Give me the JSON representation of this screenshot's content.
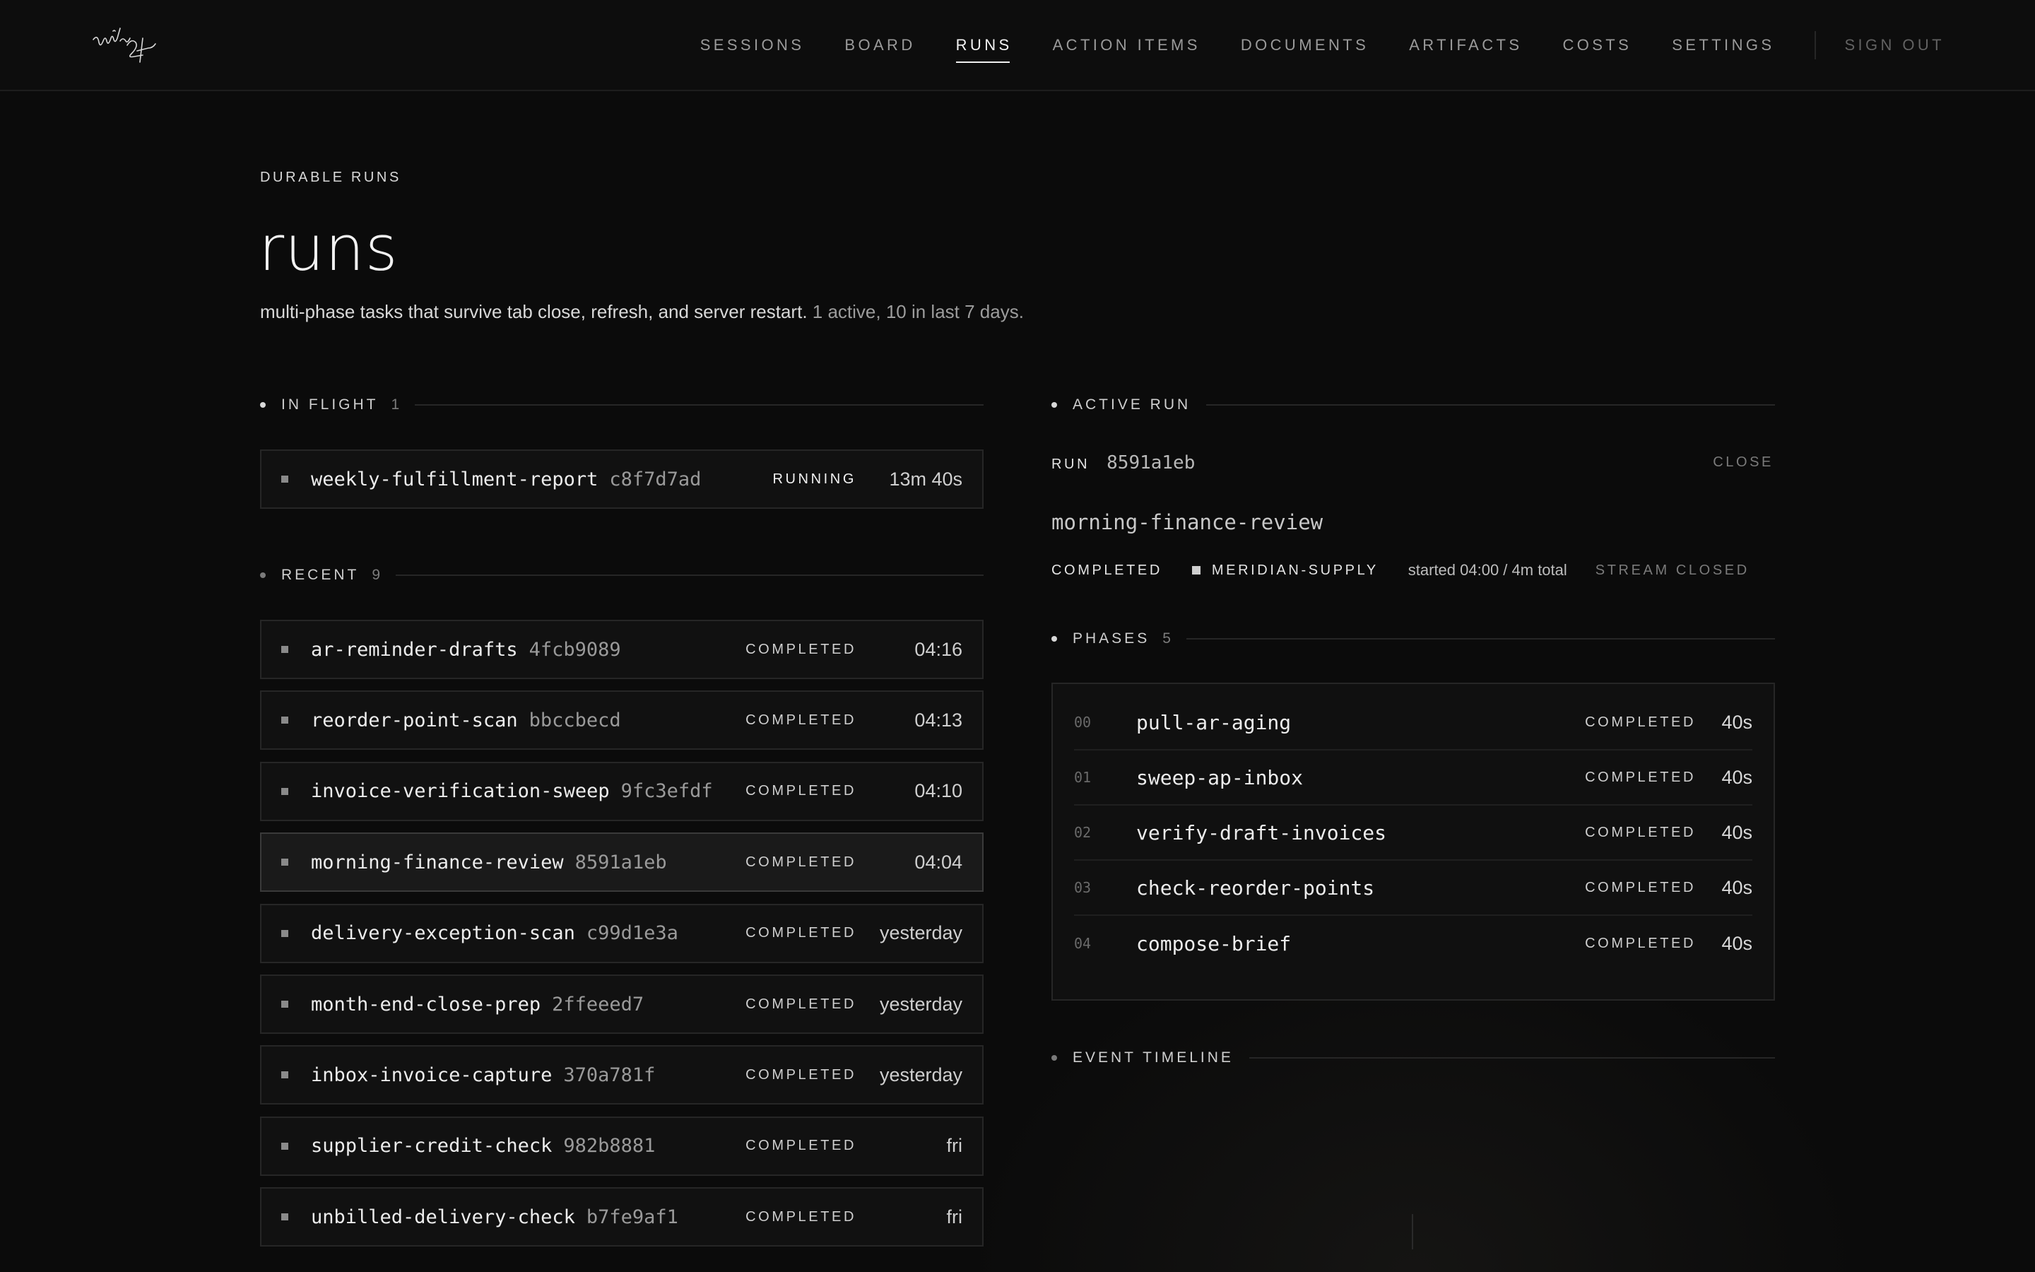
{
  "nav": {
    "items": [
      {
        "label": "SESSIONS",
        "active": false
      },
      {
        "label": "BOARD",
        "active": false
      },
      {
        "label": "RUNS",
        "active": true
      },
      {
        "label": "ACTION ITEMS",
        "active": false
      },
      {
        "label": "DOCUMENTS",
        "active": false
      },
      {
        "label": "ARTIFACTS",
        "active": false
      },
      {
        "label": "COSTS",
        "active": false
      },
      {
        "label": "SETTINGS",
        "active": false
      }
    ],
    "signout": "SIGN OUT"
  },
  "hero": {
    "eyebrow": "DURABLE RUNS",
    "title": "runs",
    "subtitle": "multi-phase tasks that survive tab close, refresh, and server restart.",
    "summary": "1 active, 10 in last 7 days."
  },
  "in_flight": {
    "label": "IN FLIGHT",
    "count": "1",
    "runs": [
      {
        "name": "weekly-fulfillment-report",
        "hash": "c8f7d7ad",
        "status": "RUNNING",
        "time": "13m 40s"
      }
    ]
  },
  "recent": {
    "label": "RECENT",
    "count": "9",
    "runs": [
      {
        "name": "ar-reminder-drafts",
        "hash": "4fcb9089",
        "status": "COMPLETED",
        "time": "04:16"
      },
      {
        "name": "reorder-point-scan",
        "hash": "bbccbecd",
        "status": "COMPLETED",
        "time": "04:13"
      },
      {
        "name": "invoice-verification-sweep",
        "hash": "9fc3efdf",
        "status": "COMPLETED",
        "time": "04:10"
      },
      {
        "name": "morning-finance-review",
        "hash": "8591a1eb",
        "status": "COMPLETED",
        "time": "04:04"
      },
      {
        "name": "delivery-exception-scan",
        "hash": "c99d1e3a",
        "status": "COMPLETED",
        "time": "yesterday"
      },
      {
        "name": "month-end-close-prep",
        "hash": "2ffeeed7",
        "status": "COMPLETED",
        "time": "yesterday"
      },
      {
        "name": "inbox-invoice-capture",
        "hash": "370a781f",
        "status": "COMPLETED",
        "time": "yesterday"
      },
      {
        "name": "supplier-credit-check",
        "hash": "982b8881",
        "status": "COMPLETED",
        "time": "fri"
      },
      {
        "name": "unbilled-delivery-check",
        "hash": "b7fe9af1",
        "status": "COMPLETED",
        "time": "fri"
      }
    ]
  },
  "active_run": {
    "section_label": "ACTIVE RUN",
    "run_label": "RUN",
    "id": "8591a1eb",
    "close_label": "CLOSE",
    "name": "morning-finance-review",
    "status": "COMPLETED",
    "project": "MERIDIAN-SUPPLY",
    "started": "started 04:00 / 4m total",
    "stream": "STREAM CLOSED"
  },
  "phases": {
    "label": "PHASES",
    "count": "5",
    "items": [
      {
        "idx": "00",
        "name": "pull-ar-aging",
        "status": "COMPLETED",
        "duration": "40s"
      },
      {
        "idx": "01",
        "name": "sweep-ap-inbox",
        "status": "COMPLETED",
        "duration": "40s"
      },
      {
        "idx": "02",
        "name": "verify-draft-invoices",
        "status": "COMPLETED",
        "duration": "40s"
      },
      {
        "idx": "03",
        "name": "check-reorder-points",
        "status": "COMPLETED",
        "duration": "40s"
      },
      {
        "idx": "04",
        "name": "compose-brief",
        "status": "COMPLETED",
        "duration": "40s"
      }
    ]
  },
  "timeline": {
    "label": "EVENT TIMELINE"
  },
  "selected_run_index": 3
}
